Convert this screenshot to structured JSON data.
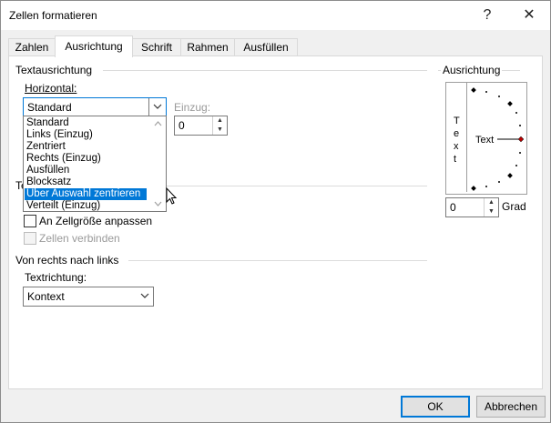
{
  "window": {
    "title": "Zellen formatieren",
    "help_label": "?",
    "close_label": "✕"
  },
  "tabs": [
    {
      "label": "Zahlen",
      "active": false
    },
    {
      "label": "Ausrichtung",
      "active": true
    },
    {
      "label": "Schrift",
      "active": false
    },
    {
      "label": "Rahmen",
      "active": false
    },
    {
      "label": "Ausfüllen",
      "active": false
    }
  ],
  "text_alignment": {
    "group_label": "Textausrichtung",
    "horizontal_label": "Horizontal:",
    "horizontal_value": "Standard",
    "indent_label": "Einzug:",
    "indent_value": "0",
    "dropdown_options": [
      "Standard",
      "Links (Einzug)",
      "Zentriert",
      "Rechts (Einzug)",
      "Ausfüllen",
      "Blocksatz",
      "Über Auswahl zentrieren",
      "Verteilt (Einzug)"
    ],
    "highlighted_option": "Über Auswahl zentrieren"
  },
  "text_control": {
    "group_label_partial": "Te",
    "shrink_to_fit_label": "An Zellgröße anpassen",
    "merge_cells_label": "Zellen verbinden"
  },
  "right_to_left": {
    "group_label": "Von rechts nach links",
    "direction_label": "Textrichtung:",
    "direction_value": "Kontext"
  },
  "orientation": {
    "group_label": "Ausrichtung",
    "vertical_text": [
      "T",
      "e",
      "x",
      "t"
    ],
    "dial_label": "Text",
    "degrees_value": "0",
    "degrees_label": "Grad",
    "accent_color": "#c00000"
  },
  "footer": {
    "ok_label": "OK",
    "cancel_label": "Abbrechen"
  }
}
